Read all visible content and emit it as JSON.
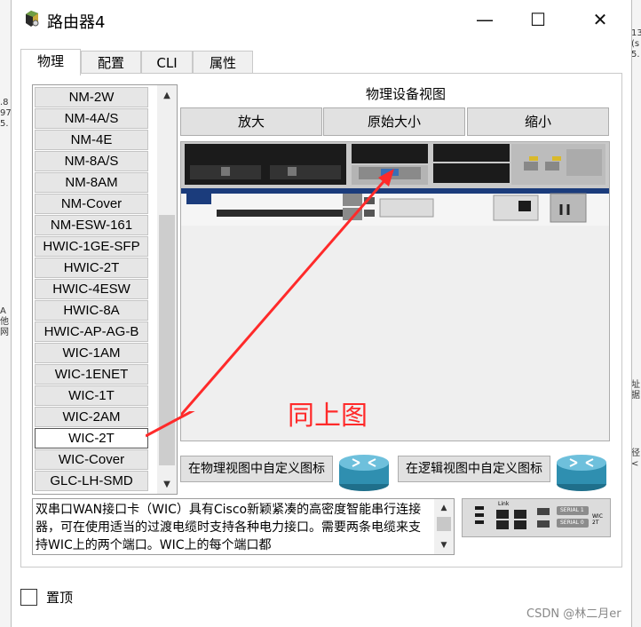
{
  "window": {
    "title": "路由器4",
    "minimize_glyph": "—",
    "maximize_glyph": "☐",
    "close_glyph": "✕"
  },
  "tabs": [
    {
      "label": "物理",
      "active": true
    },
    {
      "label": "配置",
      "active": false
    },
    {
      "label": "CLI",
      "active": false
    },
    {
      "label": "属性",
      "active": false
    }
  ],
  "module_list": {
    "items": [
      "NM-2W",
      "NM-4A/S",
      "NM-4E",
      "NM-8A/S",
      "NM-8AM",
      "NM-Cover",
      "NM-ESW-161",
      "HWIC-1GE-SFP",
      "HWIC-2T",
      "HWIC-4ESW",
      "HWIC-8A",
      "HWIC-AP-AG-B",
      "WIC-1AM",
      "WIC-1ENET",
      "WIC-1T",
      "WIC-2AM",
      "WIC-2T",
      "WIC-Cover",
      "GLC-LH-SMD"
    ],
    "selected": "WIC-2T"
  },
  "physical_view": {
    "title": "物理设备视图",
    "zoom_in": "放大",
    "original_size": "原始大小",
    "zoom_out": "缩小",
    "annotation": "同上图"
  },
  "custom_icons": {
    "physical": "在物理视图中自定义图标",
    "logical": "在逻辑视图中自定义图标"
  },
  "description": "双串口WAN接口卡（WIC）具有Cisco新颖紧凑的高密度智能串行连接器，可在使用适当的过渡电缆时支持各种电力接口。需要两条电缆来支持WIC上的两个端口。WIC上的每个端口都",
  "wic_thumbnail": {
    "label_1": "SERIAL 1",
    "label_0": "SERIAL 0",
    "link": "Link",
    "model": "WIC 2T"
  },
  "always_on_top": {
    "label": "置顶",
    "checked": false
  },
  "watermark": "CSDN @林二月er",
  "colors": {
    "annotation_red": "#ff2a2a",
    "router_blue": "#2f8fb0"
  }
}
